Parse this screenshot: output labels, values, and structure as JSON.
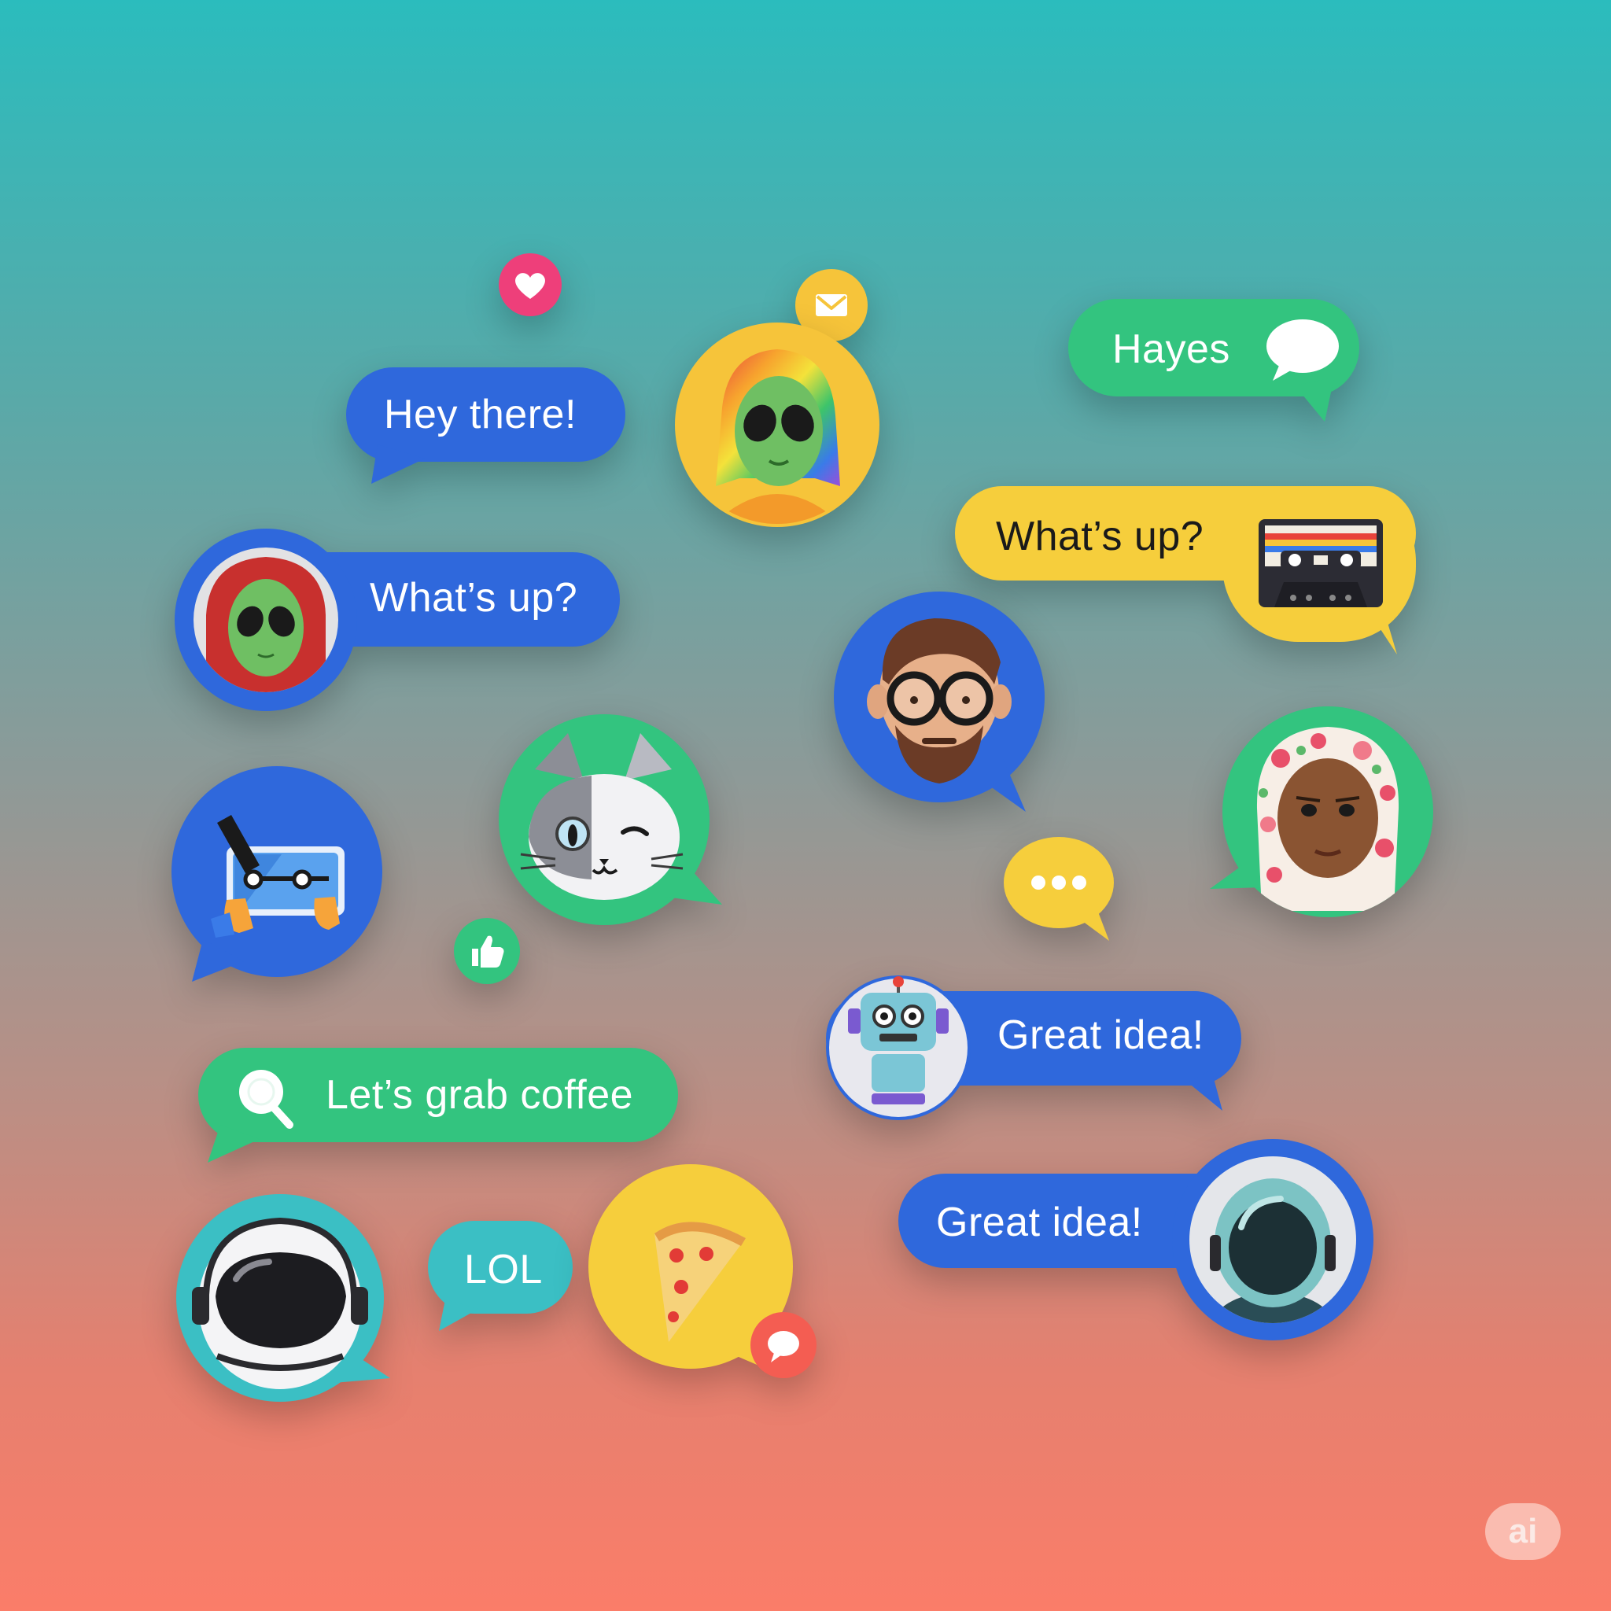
{
  "messages": {
    "hey_there": "Hey there!",
    "whats_up_left": "What’s up?",
    "hayes": "Hayes",
    "whats_up_right": "What’s up?",
    "great_idea_robot": "Great idea!",
    "lets_grab_coffee": "Let’s grab coffee",
    "lol": "LOL",
    "great_idea_astronaut": "Great idea!"
  },
  "badge": {
    "label": "ai"
  },
  "colors": {
    "blue": "#2f68dc",
    "green": "#33c47f",
    "yellow": "#f6ce3c",
    "teal": "#3bbfc4",
    "pink": "#ee3f7a",
    "coral": "#f45d52"
  },
  "icons": [
    "heart-icon",
    "mail-icon",
    "speech-bubble-icon",
    "cassette-icon",
    "thumbs-up-icon",
    "ellipsis-icon",
    "search-icon",
    "pizza-icon",
    "chat-icon"
  ]
}
